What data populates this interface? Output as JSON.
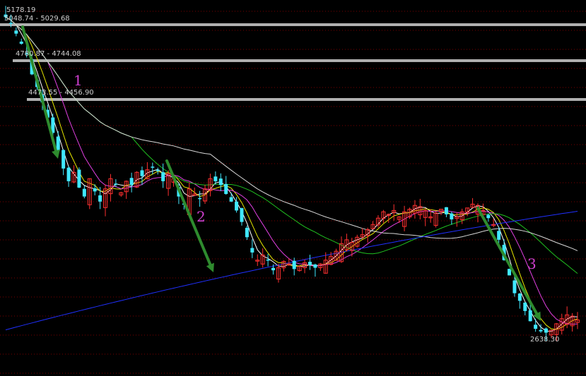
{
  "chart_data": {
    "type": "candlestick",
    "price_labels": {
      "high": "5178.19",
      "low": "2638.30"
    },
    "support_zones": [
      {
        "label": "5048.74 - 5029.68",
        "low": 5029.68,
        "high": 5048.74
      },
      {
        "label": "4780.87 - 4744.08",
        "low": 4744.08,
        "high": 4780.87
      },
      {
        "label": "4473.55 - 4456.90",
        "low": 4456.9,
        "high": 4456.9
      }
    ],
    "decline_markers": [
      "1",
      "2",
      "3"
    ],
    "moving_average_colors": {
      "ma_fast": "#ffffff",
      "ma_mid": "#e8e800",
      "ma_slow": "#e040e0",
      "ma_long": "#20c020",
      "ma_longer": "#d8d8d8",
      "ma_longest": "#2030ff"
    },
    "candle_colors": {
      "up": "#ff3030",
      "down": "#40e8ff"
    },
    "arrow_color": "#2e8b2e",
    "price_range": [
      2560,
      5260
    ],
    "closes": [
      5170,
      5120,
      5040,
      4960,
      4880,
      4720,
      4620,
      4500,
      4380,
      4260,
      4120,
      3980,
      3880,
      3950,
      3830,
      3760,
      3900,
      3800,
      3720,
      3820,
      3900,
      3860,
      3790,
      3880,
      3850,
      3950,
      3920,
      3970,
      3990,
      3960,
      3880,
      3940,
      3900,
      3760,
      3700,
      3820,
      3780,
      3740,
      3820,
      3900,
      3880,
      3850,
      3780,
      3720,
      3650,
      3560,
      3440,
      3320,
      3260,
      3300,
      3260,
      3180,
      3200,
      3250,
      3230,
      3190,
      3210,
      3240,
      3220,
      3200,
      3230,
      3260,
      3290,
      3330,
      3390,
      3420,
      3400,
      3440,
      3460,
      3500,
      3540,
      3590,
      3640,
      3620,
      3650,
      3600,
      3640,
      3660,
      3690,
      3680,
      3650,
      3600,
      3630,
      3660,
      3620,
      3580,
      3600,
      3640,
      3670,
      3700,
      3690,
      3650,
      3590,
      3540,
      3420,
      3260,
      3140,
      3000,
      2940,
      2860,
      2780,
      2720,
      2700,
      2690,
      2710,
      2760,
      2800,
      2830,
      2820,
      2790
    ],
    "xlabel": "",
    "ylabel": "",
    "title": ""
  }
}
